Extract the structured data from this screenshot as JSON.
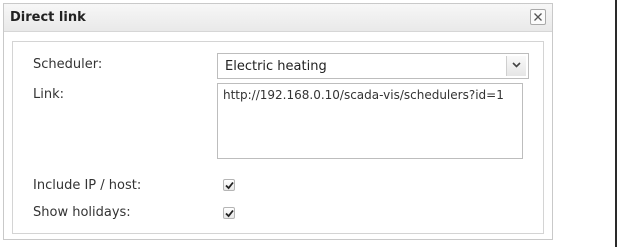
{
  "dialog": {
    "title": "Direct link",
    "close_icon": "close-icon"
  },
  "form": {
    "scheduler_label": "Scheduler:",
    "scheduler_value": "Electric heating",
    "link_label": "Link:",
    "link_value": "http://192.168.0.10/scada-vis/schedulers?id=1",
    "include_ip_label": "Include IP / host:",
    "include_ip_checked": true,
    "show_holidays_label": "Show holidays:",
    "show_holidays_checked": true
  }
}
